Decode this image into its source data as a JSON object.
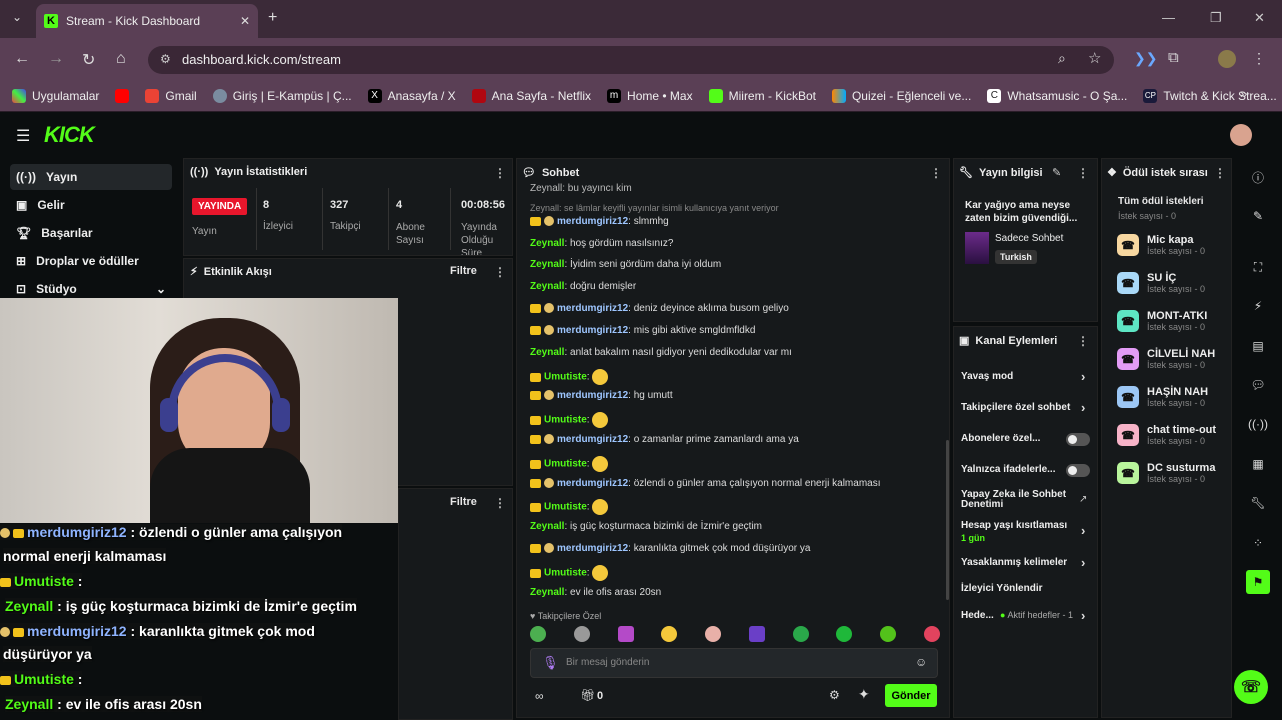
{
  "browser": {
    "tab_title": "Stream - Kick Dashboard",
    "url": "dashboard.kick.com/stream",
    "bookmarks": [
      "Uygulamalar",
      "",
      "Gmail",
      "Giriş | E-Kampüs | Ç...",
      "Anasayfa / X",
      "Ana Sayfa - Netflix",
      "Home • Max",
      "Miirem - KickBot",
      "Quizei - Eğlenceli ve...",
      "Whatsamusic - O Şa...",
      "Twitch & Kick Strea..."
    ]
  },
  "logo": "KICK",
  "sidebar": {
    "items": [
      "Yayın",
      "Gelir",
      "Başarılar",
      "Droplar ve ödüller",
      "Stüdyo"
    ]
  },
  "stats": {
    "title": "Yayın İstatistikleri",
    "live_badge": "YAYINDA",
    "live_label": "Yayın",
    "items": [
      {
        "value": "8",
        "label": "İzleyici"
      },
      {
        "value": "327",
        "label": "Takipçi"
      },
      {
        "value": "4",
        "label": "Abone Sayısı"
      },
      {
        "value": "00:08:56",
        "label": "Yayında Olduğu Süre"
      }
    ]
  },
  "activity": {
    "title": "Etkinlik Akışı",
    "filter": "Filtre",
    "filter2": "Filtre"
  },
  "chat": {
    "title": "Sohbet",
    "top_line": "Zeynall: bu yayıncı kim",
    "reply_hint": "Zeynall: se lâmlar keyifli yayınlar isimli kullanıcıya yanıt veriyor",
    "lines": [
      {
        "user": "merdumgiriz12",
        "text": "slmmhg",
        "ucls": "u1",
        "badge": "b2"
      },
      {
        "user": "Zeynall",
        "text": "hoş gördüm nasılsınız?",
        "ucls": "u3",
        "badge": ""
      },
      {
        "user": "Zeynall",
        "text": "İyidim seni gördüm daha iyi oldum",
        "ucls": "u3",
        "badge": ""
      },
      {
        "user": "Zeynall",
        "text": "doğru demişler",
        "ucls": "u3",
        "badge": ""
      },
      {
        "user": "merdumgiriz12",
        "text": "deniz deyince aklıma busom geliyo",
        "ucls": "u1",
        "badge": "b2"
      },
      {
        "user": "merdumgiriz12",
        "text": "mis gibi aktive smgldmfldkd",
        "ucls": "u1",
        "badge": "b2"
      },
      {
        "user": "Zeynall",
        "text": "anlat bakalım nasıl gidiyor yeni dedikodular var mı",
        "ucls": "u3",
        "badge": ""
      },
      {
        "user": "Umutiste",
        "text": "",
        "ucls": "u2",
        "badge": "b1"
      },
      {
        "user": "merdumgiriz12",
        "text": "hg umutt",
        "ucls": "u1",
        "badge": "b2"
      },
      {
        "user": "Umutiste",
        "text": "",
        "ucls": "u2",
        "badge": "b1"
      },
      {
        "user": "merdumgiriz12",
        "text": "o zamanlar prime zamanlardı ama ya",
        "ucls": "u1",
        "badge": "b2"
      },
      {
        "user": "Umutiste",
        "text": "",
        "ucls": "u2",
        "badge": "b1"
      },
      {
        "user": "merdumgiriz12",
        "text": "özlendi o günler ama çalışıyon normal enerji kalmaması",
        "ucls": "u1",
        "badge": "b2"
      },
      {
        "user": "Umutiste",
        "text": "",
        "ucls": "u2",
        "badge": "b1"
      },
      {
        "user": "Zeynall",
        "text": "iş güç koşturmaca bizimki de İzmir'e geçtim",
        "ucls": "u3",
        "badge": ""
      },
      {
        "user": "merdumgiriz12",
        "text": "karanlıkta gitmek çok mod düşürüyor ya",
        "ucls": "u1",
        "badge": "b2"
      },
      {
        "user": "Umutiste",
        "text": "",
        "ucls": "u2",
        "badge": "b1"
      },
      {
        "user": "Zeynall",
        "text": "ev ile ofis arası 20sn",
        "ucls": "u3",
        "badge": ""
      }
    ],
    "followers_only": "Takipçilere Özel",
    "input_placeholder": "Bir mesaj gönderin",
    "count": "0",
    "send": "Gönder"
  },
  "stream_info": {
    "title": "Yayın bilgisi",
    "stream_title": "Kar yağıyo ama neyse zaten bizim güvendiği...",
    "category": "Sadece Sohbet",
    "language": "Turkish"
  },
  "channel_actions": {
    "title": "Kanal Eylemleri",
    "items": [
      "Yavaş mod",
      "Takipçilere özel sohbet",
      "Abonelere özel...",
      "Yalnızca ifadelerle...",
      "Yapay Zeka ile Sohbet Denetimi",
      "Hesap yaşı kısıtlaması",
      "Yasaklanmış kelimeler",
      "İzleyici Yönlendir",
      "Hede..."
    ],
    "age_sub": "1 gün",
    "goals": "Aktif hedefler - 1"
  },
  "rewards": {
    "title": "Ödül istek sırası",
    "all": "Tüm ödül istekleri",
    "all_sub": "İstek sayısı - 0",
    "items": [
      {
        "name": "Mic kapa",
        "sub": "İstek sayısı - 0",
        "color": "#f7d7a0"
      },
      {
        "name": "SU İÇ",
        "sub": "İstek sayısı - 0",
        "color": "#a9d8f7"
      },
      {
        "name": "MONT-ATKI",
        "sub": "İstek sayısı - 0",
        "color": "#5ee6c4"
      },
      {
        "name": "CİLVELİ NAH",
        "sub": "İstek sayısı - 0",
        "color": "#e39cf5"
      },
      {
        "name": "HAŞİN NAH",
        "sub": "İstek sayısı - 0",
        "color": "#9cc7f5"
      },
      {
        "name": "chat time-out",
        "sub": "İstek sayısı - 0",
        "color": "#f7b3c8"
      },
      {
        "name": "DC susturma",
        "sub": "İstek sayısı - 0",
        "color": "#b9f59c"
      }
    ]
  },
  "overlay": {
    "lines": [
      {
        "user": "merdumgiriz12",
        "text": " : özlendi o günler  ama çalışıyon"
      },
      {
        "user": "",
        "text": "normal enerji kalmaması"
      },
      {
        "user": "Umutiste",
        "text": " : "
      },
      {
        "user": "Zeynall",
        "text": " : iş güç koşturmaca bizimki de İzmir'e geçtim"
      },
      {
        "user": "merdumgiriz12",
        "text": " : karanlıkta gitmek çok mod"
      },
      {
        "user": "",
        "text": "düşürüyor ya"
      },
      {
        "user": "Umutiste",
        "text": " : "
      },
      {
        "user": "Zeynall",
        "text": " : ev ile ofis arası 20sn"
      }
    ]
  }
}
